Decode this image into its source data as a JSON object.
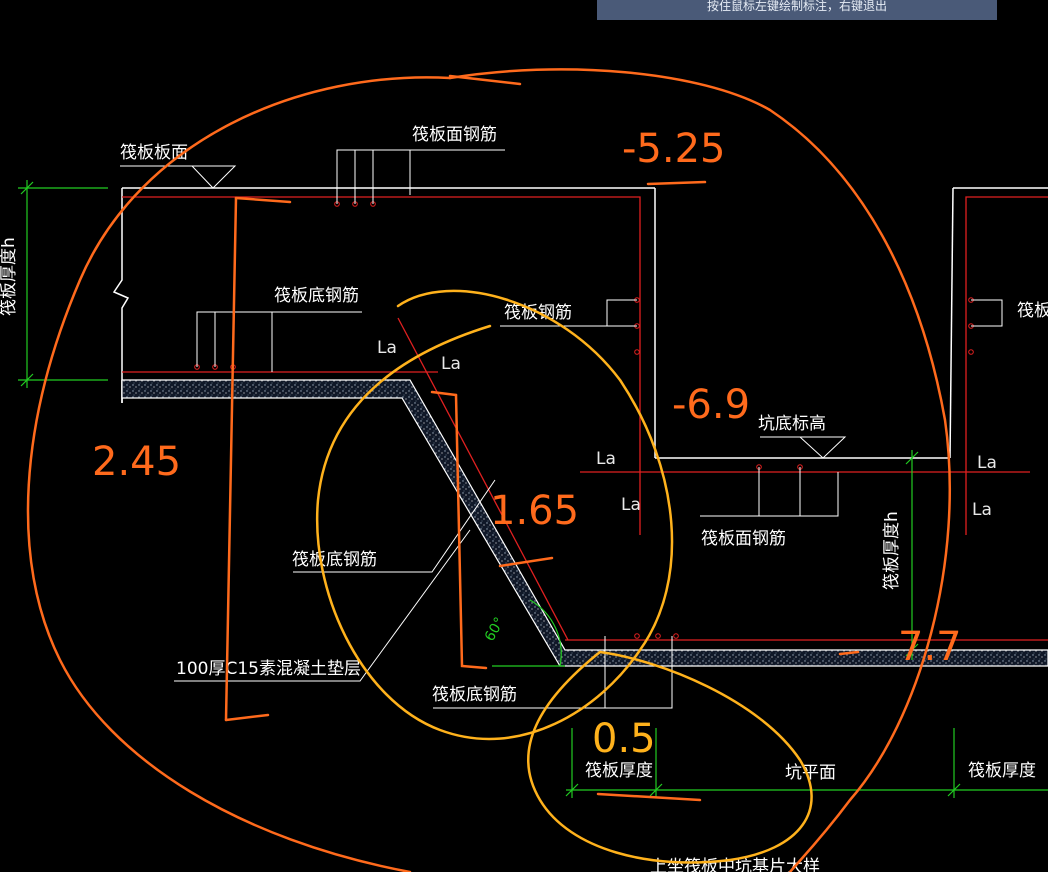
{
  "status_bar": {
    "hint": "按住鼠标左键绘制标注，右键退出"
  },
  "labels": {
    "raft_top": "筏板板面",
    "raft_top_rebar": "筏板面钢筋",
    "raft_thickness_h": "筏板厚度h",
    "raft_bottom_rebar_1": "筏板底钢筋",
    "raft_rebar_mid": "筏板钢筋",
    "raft_rebar_right": "筏板钢",
    "pit_bottom_elevation": "坑底标高",
    "raft_top_rebar_2": "筏板面钢筋",
    "raft_thickness_h_2": "筏板厚度h",
    "raft_bottom_rebar_2": "筏板底钢筋",
    "c15_cushion": "100厚C15素混凝土垫层",
    "raft_bottom_rebar_3": "筏板底钢筋",
    "raft_thickness_left": "筏板厚度",
    "pit_plane": "坑平面",
    "raft_thickness_right": "筏板厚度",
    "angle": "60°",
    "la_labels": [
      "La",
      "La",
      "La",
      "La",
      "La",
      "La"
    ],
    "bottom_caption": "上坐筏板中坑基片大样"
  },
  "annotations": {
    "val_top": "-5.25",
    "val_left": "2.45",
    "val_mid": "-6.9",
    "val_slope": "1.65",
    "val_bottom": "0.5",
    "val_right": "7.7"
  },
  "colors": {
    "structure": "#ffffff",
    "rebar": "#e02020",
    "dim": "#22cc22",
    "hand_orange": "#ff6a1c",
    "hand_yellow": "#ffb21c",
    "banner": "#4a5a78"
  }
}
